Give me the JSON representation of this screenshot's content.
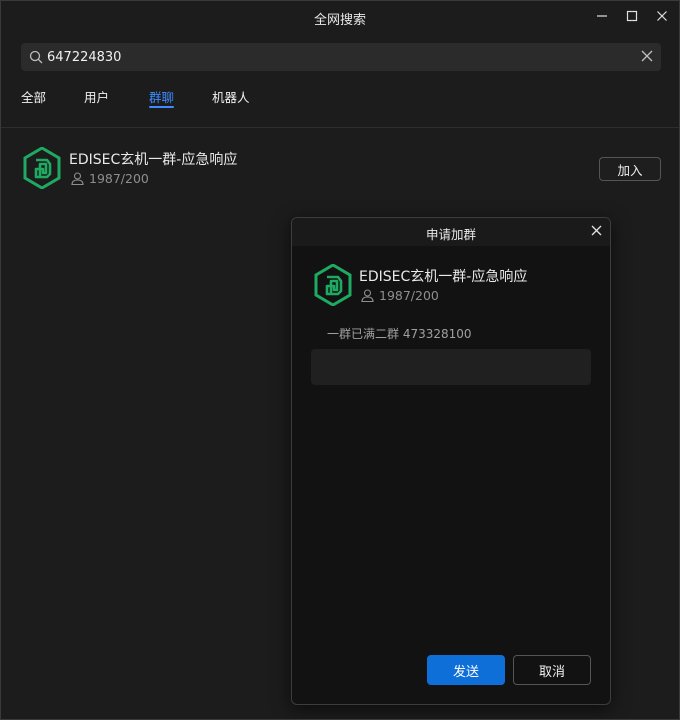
{
  "window": {
    "title": "全网搜索"
  },
  "search": {
    "value": "647224830",
    "placeholder": ""
  },
  "tabs": [
    {
      "label": "全部",
      "active": false
    },
    {
      "label": "用户",
      "active": false
    },
    {
      "label": "群聊",
      "active": true
    },
    {
      "label": "机器人",
      "active": false
    }
  ],
  "result": {
    "name": "EDISEC玄机一群-应急响应",
    "members": "1987/200",
    "join_label": "加入"
  },
  "dialog": {
    "title": "申请加群",
    "group_name": "EDISEC玄机一群-应急响应",
    "members": "1987/200",
    "description": "一群已满二群 473328100",
    "message_value": "",
    "send_label": "发送",
    "cancel_label": "取消"
  },
  "colors": {
    "accent": "#3c8cff",
    "primary_button": "#0f6fd8",
    "logo_green": "#1faa62"
  },
  "icons": {
    "search": "search-icon",
    "clear": "close-icon",
    "minimize": "minimize-icon",
    "maximize": "maximize-icon",
    "close": "close-icon",
    "members": "person-icon",
    "logo": "edisec-logo-icon"
  }
}
